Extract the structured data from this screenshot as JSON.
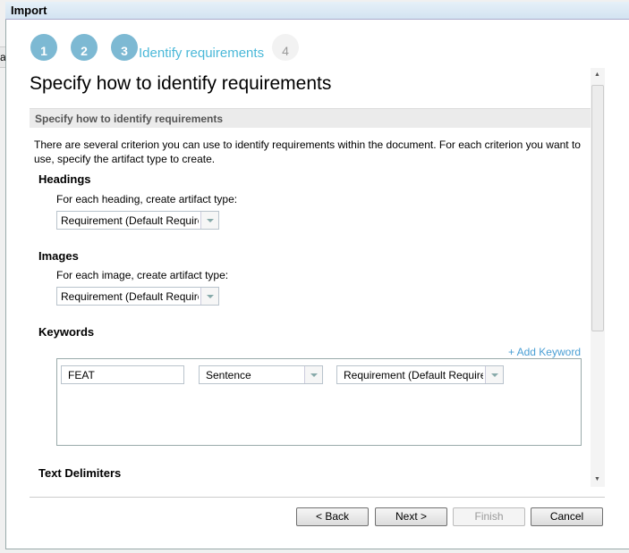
{
  "background": {
    "partial_char": "a"
  },
  "window": {
    "title": "Import"
  },
  "wizard": {
    "steps": [
      {
        "number": "1",
        "state": "done"
      },
      {
        "number": "2",
        "state": "done"
      },
      {
        "number": "3",
        "state": "current",
        "label": "Identify requirements"
      },
      {
        "number": "4",
        "state": "pending"
      }
    ],
    "accent": "#7db9d3"
  },
  "page": {
    "title": "Specify how to identify requirements",
    "section_title": "Specify how to identify requirements",
    "description": "There are several criterion you can use to identify requirements within the document. For each criterion you want to use, specify the artifact type to create."
  },
  "headings": {
    "title": "Headings",
    "label": "For each heading, create artifact type:",
    "value": "Requirement (Default Requirement)"
  },
  "images": {
    "title": "Images",
    "label": "For each image, create artifact type:",
    "value": "Requirement (Default Requirement)"
  },
  "keywords": {
    "title": "Keywords",
    "add_label": "+ Add Keyword",
    "rows": [
      {
        "keyword": "FEAT",
        "scope": "Sentence",
        "artifact_type": "Requirement (Default Requirement)"
      }
    ]
  },
  "text_delimiters": {
    "title": "Text Delimiters"
  },
  "buttons": {
    "back": "< Back",
    "next": "Next >",
    "finish": "Finish",
    "cancel": "Cancel"
  }
}
